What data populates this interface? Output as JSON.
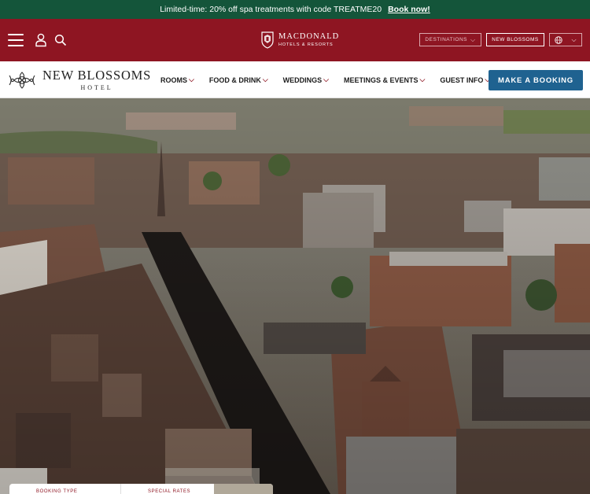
{
  "promo": {
    "text": "Limited-time: 20% off spa treatments with code TREATME20",
    "link": "Book now!"
  },
  "brand": {
    "name": "MACDONALD",
    "tagline": "HOTELS & RESORTS",
    "destinations": "Destinations",
    "hotel_button": "New Blossoms",
    "colors": {
      "bar": "#8e1522",
      "promo": "#14553a",
      "cta": "#1f6290"
    }
  },
  "hotel": {
    "name": "NEW BLOSSOMS",
    "sub": "HOTEL"
  },
  "nav": {
    "items": [
      {
        "label": "ROOMS"
      },
      {
        "label": "FOOD & DRINK"
      },
      {
        "label": "WEDDINGS"
      },
      {
        "label": "MEETINGS & EVENTS"
      },
      {
        "label": "GUEST INFO"
      }
    ],
    "cta": "MAKE A BOOKING"
  },
  "booking": {
    "type_label": "BOOKING TYPE",
    "rates_label": "SPECIAL RATES"
  },
  "icons": {
    "menu": "hamburger-icon",
    "account": "user-icon",
    "search": "search-icon",
    "language": "globe-icon"
  }
}
